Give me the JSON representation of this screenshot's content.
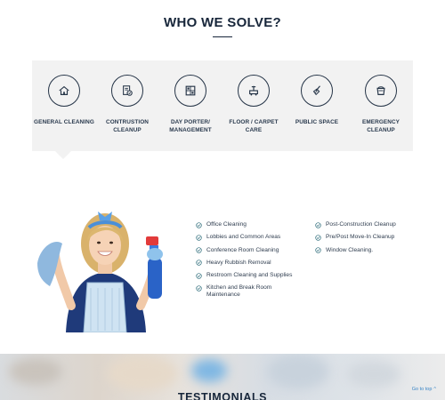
{
  "section": {
    "title": "WHO WE SOLVE?"
  },
  "services": [
    {
      "label": "GENERAL CLEANING",
      "icon": "home-icon"
    },
    {
      "label": "CONTRUSTION CLEANUP",
      "icon": "construction-document-icon"
    },
    {
      "label": "DAY PORTER/ MANAGEMENT",
      "icon": "building-window-icon"
    },
    {
      "label": "FLOOR / CARPET CARE",
      "icon": "floor-scrubber-icon"
    },
    {
      "label": "PUBLIC SPACE",
      "icon": "mop-icon"
    },
    {
      "label": "EMERGENCY CLEANUP",
      "icon": "bucket-icon"
    }
  ],
  "cleaning_list": {
    "left": [
      "Office Cleaning",
      "Lobbies and Common Areas",
      "Conference Room Cleaning",
      "Heavy Rubbish Removal",
      "Restroom Cleaning and Supplies",
      "Kitchen and Break Room Maintenance"
    ],
    "right": [
      "Post-Construction Cleanup",
      "Pre/Post Move-In Cleanup",
      "Window Cleaning."
    ]
  },
  "testimonials": {
    "title": "TESTIMONIALS"
  },
  "goto_top": {
    "label": "Go to top"
  },
  "colors": {
    "heading": "#17263a",
    "panel": "#f2f2f2",
    "accent_blue": "#3b86c6",
    "check": "#2a6a78"
  }
}
